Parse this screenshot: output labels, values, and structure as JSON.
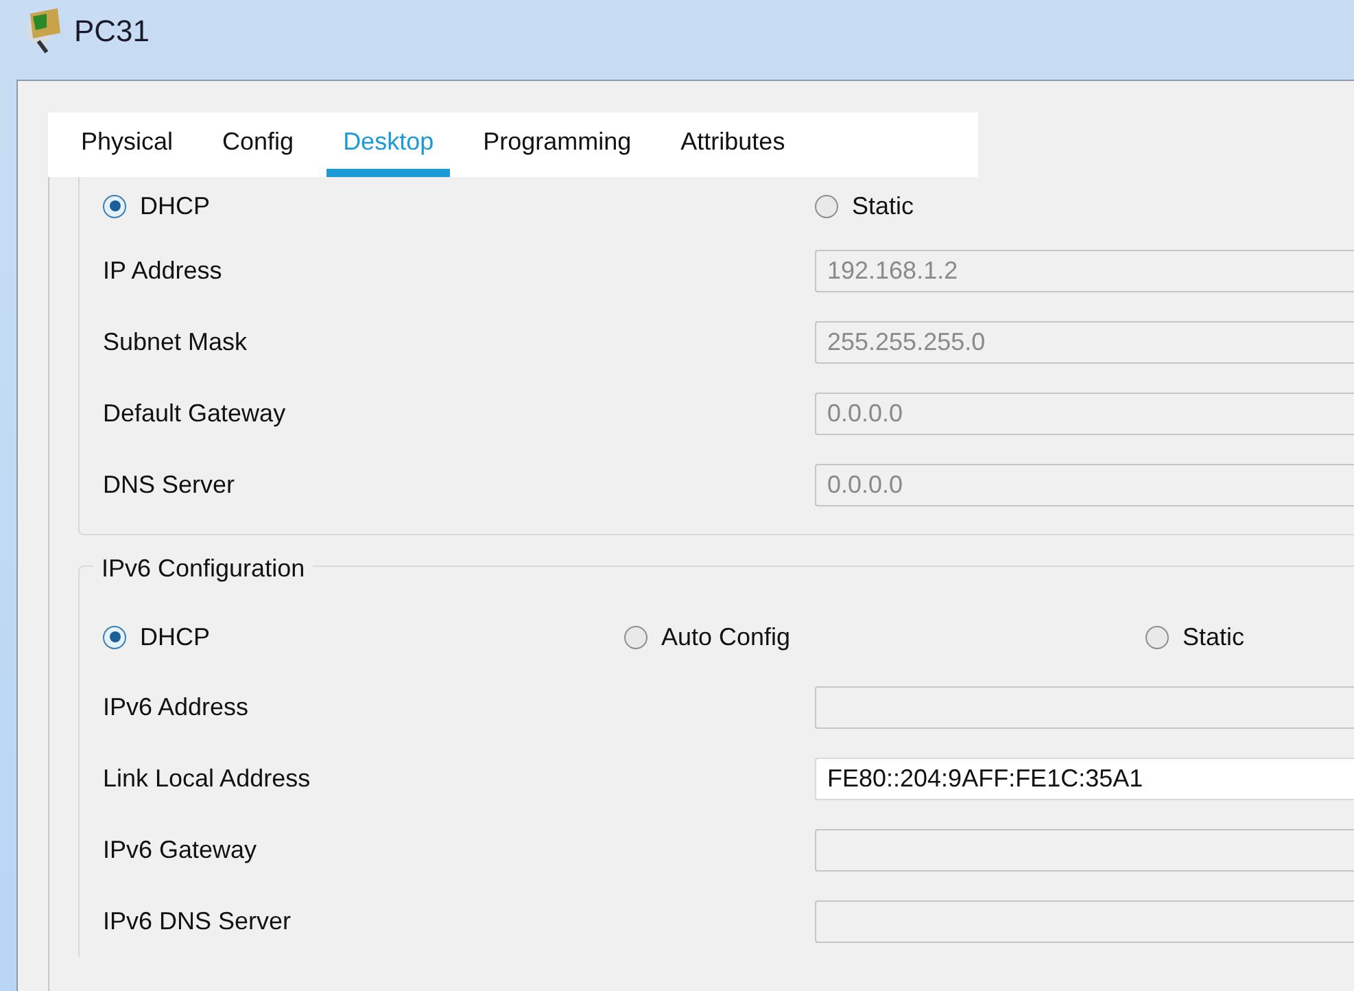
{
  "window": {
    "title": "PC31"
  },
  "tabs": [
    {
      "label": "Physical",
      "selected": false
    },
    {
      "label": "Config",
      "selected": false
    },
    {
      "label": "Desktop",
      "selected": true
    },
    {
      "label": "Programming",
      "selected": false
    },
    {
      "label": "Attributes",
      "selected": false
    }
  ],
  "ipv4": {
    "modes": [
      {
        "label": "DHCP",
        "selected": true
      },
      {
        "label": "Static",
        "selected": false
      }
    ],
    "fields": [
      {
        "label": "IP Address",
        "value": "192.168.1.2",
        "disabled": true
      },
      {
        "label": "Subnet Mask",
        "value": "255.255.255.0",
        "disabled": true
      },
      {
        "label": "Default Gateway",
        "value": "0.0.0.0",
        "disabled": true
      },
      {
        "label": "DNS Server",
        "value": "0.0.0.0",
        "disabled": true
      }
    ]
  },
  "ipv6": {
    "title": "IPv6 Configuration",
    "modes": [
      {
        "label": "DHCP",
        "selected": true
      },
      {
        "label": "Auto Config",
        "selected": false
      },
      {
        "label": "Static",
        "selected": false
      }
    ],
    "fields": [
      {
        "label": "IPv6 Address",
        "disabled": true
      },
      {
        "label": "Link Local Address",
        "value": "FE80::204:9AFF:FE1C:35A1",
        "disabled": false
      },
      {
        "label": "IPv6 Gateway",
        "disabled": true
      },
      {
        "label": "IPv6 DNS Server",
        "disabled": true
      }
    ]
  }
}
